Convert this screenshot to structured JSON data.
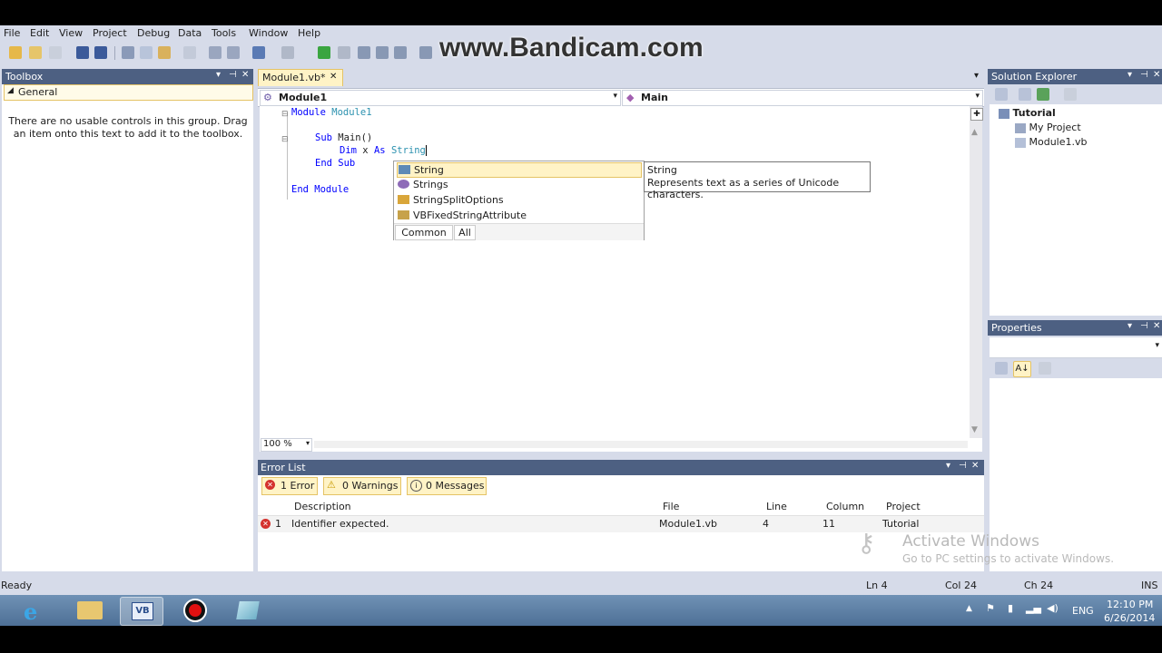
{
  "menu": [
    "File",
    "Edit",
    "View",
    "Project",
    "Debug",
    "Data",
    "Tools",
    "Window",
    "Help"
  ],
  "watermark": "www.Bandicam.com",
  "toolbox": {
    "title": "Toolbox",
    "group": "General",
    "empty_text": "There are no usable controls in this group. Drag an item onto this text to add it to the toolbox."
  },
  "editor": {
    "tab_label": "Module1.vb*",
    "nav_left": "Module1",
    "nav_right": "Main",
    "zoom": "100 %",
    "code": {
      "l1_kw": "Module",
      "l1_name": "Module1",
      "l2_kw": "Sub",
      "l2_name": "Main()",
      "l3_dim": "Dim",
      "l3_var": "x",
      "l3_as": "As",
      "l3_type": "String",
      "l4": "End Sub",
      "l5": "End Module"
    }
  },
  "completion": {
    "items": [
      "String",
      "Strings",
      "StringSplitOptions",
      "VBFixedStringAttribute"
    ],
    "tabs": [
      "Common",
      "All"
    ],
    "tooltip_title": "String",
    "tooltip_desc": "Represents text as a series of Unicode characters."
  },
  "error_list": {
    "title": "Error List",
    "filters": [
      "1 Error",
      "0 Warnings",
      "0 Messages"
    ],
    "columns": [
      "Description",
      "File",
      "Line",
      "Column",
      "Project"
    ],
    "rows": [
      {
        "num": "1",
        "description": "Identifier expected.",
        "file": "Module1.vb",
        "line": "4",
        "column": "11",
        "project": "Tutorial"
      }
    ]
  },
  "solution_explorer": {
    "title": "Solution Explorer",
    "root": "Tutorial",
    "items": [
      "My Project",
      "Module1.vb"
    ]
  },
  "properties": {
    "title": "Properties"
  },
  "status": {
    "left": "Ready",
    "ln": "Ln 4",
    "col": "Col 24",
    "ch": "Ch 24",
    "mode": "INS"
  },
  "watermark_windows": {
    "line1": "Activate Windows",
    "line2": "Go to PC settings to activate Windows."
  },
  "taskbar": {
    "lang": "ENG",
    "time": "12:10 PM",
    "date": "6/26/2014"
  }
}
